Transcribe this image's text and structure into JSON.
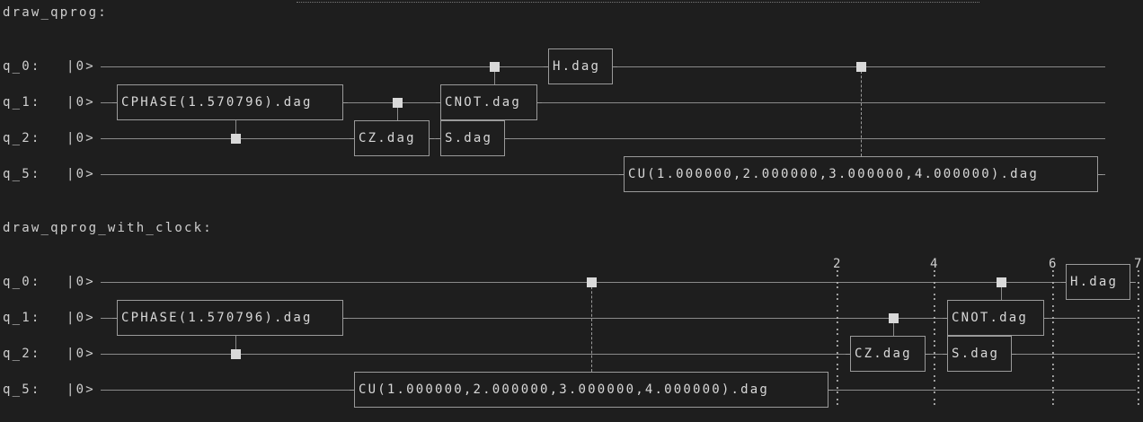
{
  "sections": {
    "prog": {
      "title": "draw_qprog:"
    },
    "clock": {
      "title": "draw_qprog_with_clock:"
    }
  },
  "qubits": [
    "q_0:",
    "q_1:",
    "q_2:",
    "q_5:"
  ],
  "ket": "|0>",
  "gates_prog": {
    "cphase": "CPHASE(1.570796).dag",
    "cz": "CZ.dag",
    "cnot": "CNOT.dag",
    "s": "S.dag",
    "h": "H.dag",
    "cu": "CU(1.000000,2.000000,3.000000,4.000000).dag"
  },
  "gates_clock": {
    "cphase": "CPHASE(1.570796).dag",
    "cu": "CU(1.000000,2.000000,3.000000,4.000000).dag",
    "cz": "CZ.dag",
    "cnot": "CNOT.dag",
    "s": "S.dag",
    "h": "H.dag"
  },
  "clock_ticks": [
    "2",
    "4",
    "6",
    "7"
  ],
  "colors": {
    "background": "#1e1e1e",
    "wire": "#8a8a8a",
    "text": "#d4d4d4",
    "control": "#d9d9d9"
  }
}
